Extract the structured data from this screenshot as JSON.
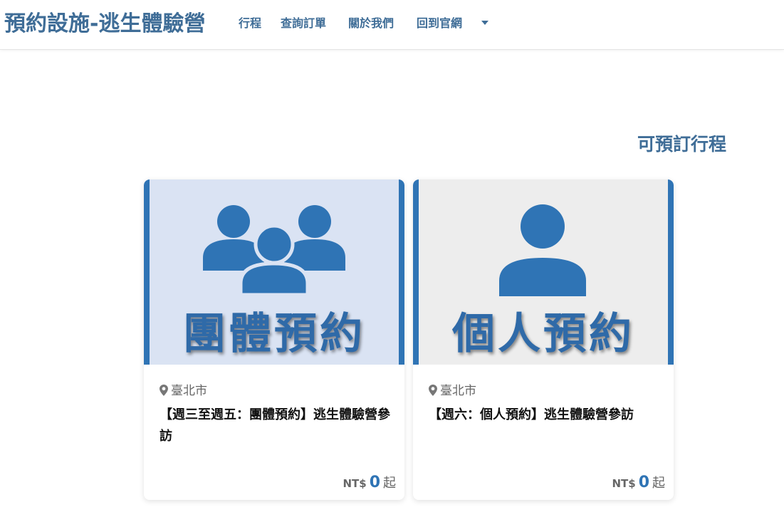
{
  "navbar": {
    "brand": "預約設施-逃生體驗營",
    "links": [
      "行程",
      "查詢訂單",
      "關於我們",
      "回到官網"
    ]
  },
  "section": {
    "title": "可預訂行程"
  },
  "cards": [
    {
      "image_label": "團體預約",
      "image_icon": "group-people-icon",
      "image_bg": "#dae3f3",
      "location": "臺北市",
      "title": "【週三至週五：團體預約】逃生體驗營參訪",
      "currency": "NT$",
      "price": "0",
      "price_suffix": "起"
    },
    {
      "image_label": "個人預約",
      "image_icon": "person-icon",
      "image_bg": "#ededed",
      "location": "臺北市",
      "title": "【週六：個人預約】逃生體驗營參訪",
      "currency": "NT$",
      "price": "0",
      "price_suffix": "起"
    }
  ],
  "colors": {
    "brand": "#3f6d97",
    "accent": "#2f74b5"
  }
}
